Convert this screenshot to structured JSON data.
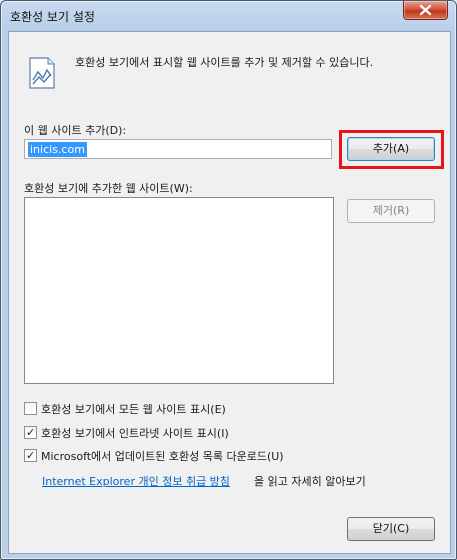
{
  "window": {
    "title": "호환성 보기 설정"
  },
  "header": {
    "description": "호환성 보기에서 표시할 웹 사이트를 추가 및 제거할 수 있습니다."
  },
  "add_site": {
    "label": "이 웹 사이트 추가(D):",
    "value": "inicis.com",
    "add_button": "추가(A)"
  },
  "site_list": {
    "label": "호환성 보기에 추가한 웹 사이트(W):",
    "items": [],
    "remove_button": "제거(R)"
  },
  "options": [
    {
      "label": "호환성 보기에서 모든 웹 사이트 표시(E)",
      "checked": false
    },
    {
      "label": "호환성 보기에서 인트라넷 사이트 표시(I)",
      "checked": true
    },
    {
      "label": "Microsoft에서 업데이트된 호환성 목록 다운로드(U)",
      "checked": true
    }
  ],
  "privacy": {
    "link_text": "Internet Explorer 개인 정보 취급 방침",
    "tail_text": "을 읽고 자세히 알아보기"
  },
  "footer": {
    "close_button": "닫기(C)"
  },
  "colors": {
    "highlight": "#e8141c",
    "selection": "#3399ff",
    "link": "#0066cc"
  }
}
